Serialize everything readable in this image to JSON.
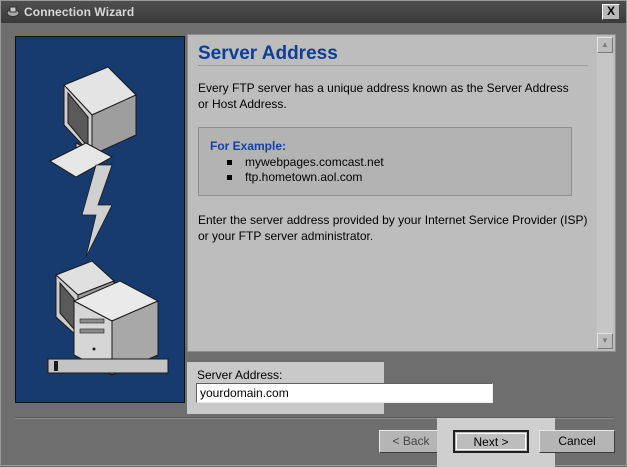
{
  "window": {
    "title": "Connection Wizard",
    "close_glyph": "X"
  },
  "page": {
    "title": "Server Address",
    "intro": "Every FTP server has a unique address known as the Server Address or Host Address.",
    "example_title": "For Example:",
    "examples": [
      "mywebpages.comcast.net",
      "ftp.hometown.aol.com"
    ],
    "instructions": "Enter the server address provided by your Internet Service Provider (ISP) or your FTP server administrator."
  },
  "field": {
    "label": "Server Address:",
    "value": "yourdomain.com"
  },
  "buttons": {
    "back": "< Back",
    "next": "Next >",
    "cancel": "Cancel"
  },
  "colors": {
    "title_blue": "#0d3e98",
    "art_panel": "#173b6e"
  }
}
